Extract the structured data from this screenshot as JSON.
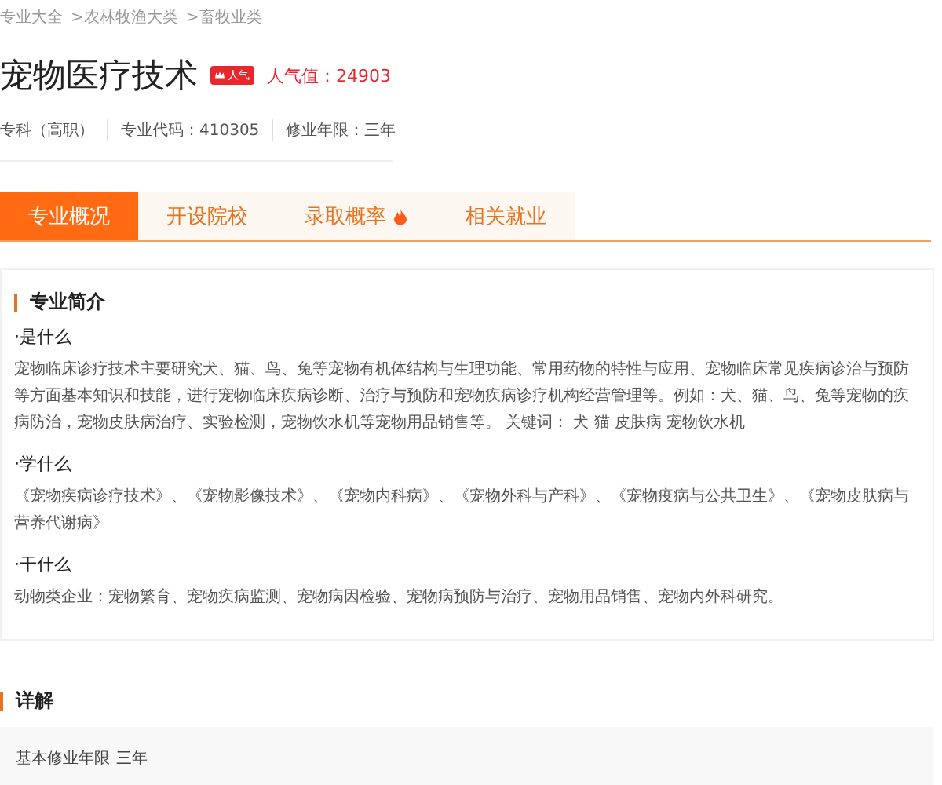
{
  "breadcrumb": [
    "专业大全",
    ">农林牧渔大类",
    ">畜牧业类"
  ],
  "title": "宠物医疗技术",
  "badge": "人气",
  "popularity": "人气值：24903",
  "meta": [
    "专科（高职）",
    "专业代码：410305",
    "修业年限：三年"
  ],
  "tabs": [
    {
      "label": "专业概况",
      "selected": true,
      "hot": false
    },
    {
      "label": "开设院校",
      "selected": false,
      "hot": false
    },
    {
      "label": "录取概率",
      "selected": false,
      "hot": true
    },
    {
      "label": "相关就业",
      "selected": false,
      "hot": false
    }
  ],
  "intro": {
    "heading": "专业简介",
    "sections": [
      {
        "title": "·是什么",
        "text": "宠物临床诊疗技术主要研究犬、猫、鸟、兔等宠物有机体结构与生理功能、常用药物的特性与应用、宠物临床常见疾病诊治与预防等方面基本知识和技能，进行宠物临床疾病诊断、治疗与预防和宠物疾病诊疗机构经营管理等。例如：犬、猫、鸟、兔等宠物的疾病防治，宠物皮肤病治疗、实验检测，宠物饮水机等宠物用品销售等。 关键词： 犬 猫 皮肤病 宠物饮水机"
      },
      {
        "title": "·学什么",
        "text": "《宠物疾病诊疗技术》、《宠物影像技术》、《宠物内科病》、《宠物外科与产科》、《宠物疫病与公共卫生》、《宠物皮肤病与营养代谢病》"
      },
      {
        "title": "·干什么",
        "text": "动物类企业：宠物繁育、宠物疾病监测、宠物病因检验、宠物病预防与治疗、宠物用品销售、宠物内外科研究。"
      }
    ]
  },
  "details": {
    "heading": "详解",
    "rows": [
      {
        "label": "基本修业年限",
        "value": "三年"
      }
    ]
  }
}
